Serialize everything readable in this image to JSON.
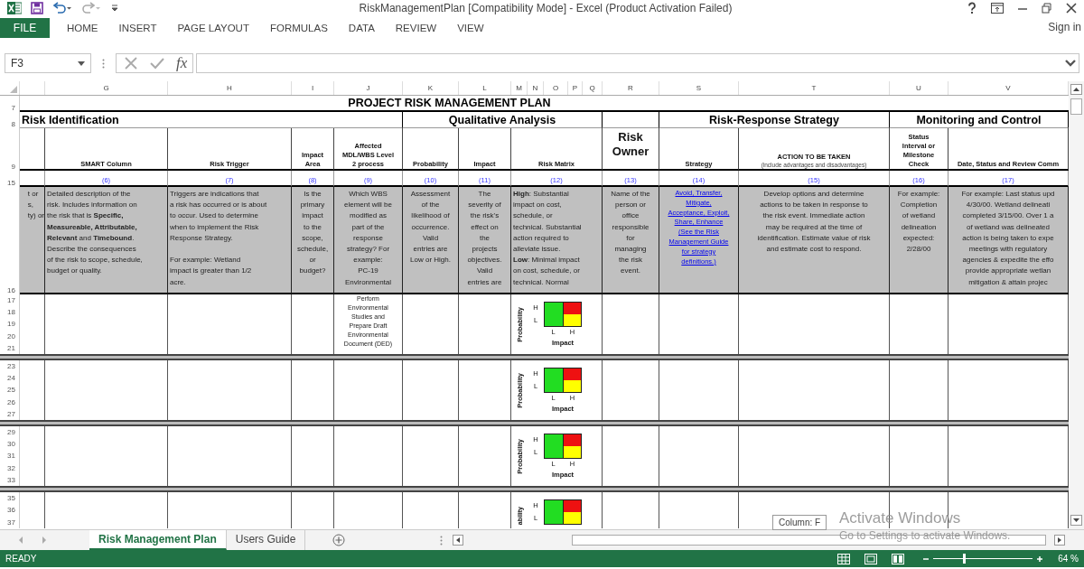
{
  "title_bar": {
    "title": "RiskManagementPlan  [Compatibility Mode] - Excel (Product Activation Failed)"
  },
  "ribbon": {
    "file_button": "FILE",
    "tabs": [
      "HOME",
      "INSERT",
      "PAGE LAYOUT",
      "FORMULAS",
      "DATA",
      "REVIEW",
      "VIEW"
    ],
    "sign_in": "Sign in"
  },
  "formula_bar": {
    "name_box": "F3",
    "function_button": "fx"
  },
  "column_headers": [
    "G",
    "H",
    "I",
    "J",
    "K",
    "L",
    "M",
    "N",
    "O",
    "P",
    "Q",
    "R",
    "S",
    "T",
    "U",
    "V"
  ],
  "sheet": {
    "row_numbers": [
      "7",
      "8",
      "9",
      "15",
      "16"
    ],
    "title": "PROJECT RISK MANAGEMENT PLAN",
    "sections": [
      "Risk Identification",
      "Qualitative Analysis",
      "Risk-Response Strategy",
      "Monitoring and Control"
    ],
    "headers": [
      {
        "label": "SMART Column",
        "kind": "normal"
      },
      {
        "label": "Risk Trigger",
        "kind": "normal"
      },
      {
        "label": "Impact\nArea",
        "kind": "normal"
      },
      {
        "label": "Affected\nMDL/WBS Level\n2 process",
        "kind": "normal"
      },
      {
        "label": "Probability",
        "kind": "normal"
      },
      {
        "label": "Impact",
        "kind": "normal"
      },
      {
        "label": "Risk Matrix",
        "kind": "normal"
      },
      {
        "label": "Risk\nOwner",
        "kind": "large"
      },
      {
        "label": "Strategy",
        "kind": "normal"
      },
      {
        "label": "ACTION TO BE TAKEN",
        "note": "(include advantages and disadvantages)",
        "kind": "normal"
      },
      {
        "label": "Status\nInterval or\nMilestone\nCheck",
        "kind": "normal"
      },
      {
        "label": "Date, Status and Review Comm",
        "kind": "normal"
      }
    ],
    "numbers": [
      "(6)",
      "(7)",
      "(8)",
      "(9)",
      "(10)",
      "(11)",
      "(12)",
      "(13)",
      "(14)",
      "(15)",
      "(16)",
      "(17)"
    ],
    "cut_text": "t or\ns,\nty) or",
    "descriptions": [
      {
        "text": "Detailed description of the\nrisk. Includes information on\nthe risk that is **Specific,**\n**Measureable, Attributable,**\n**Relevant** and **Timebound**.\nDescribe the consequences\nof the risk to scope, schedule,\nbudget or quality.",
        "kind": "text"
      },
      {
        "text": "Triggers are indications that\na risk has occurred or is about\nto occur. Used to determine\nwhen to implement the Risk\nResponse Strategy.\n\nFor example: Wetland\nimpact is greater than 1/2\nacre.",
        "kind": "text"
      },
      {
        "text": "Is the\nprimary\nimpact\nto the\nscope,\nschedule,\nor\nbudget?",
        "kind": "text"
      },
      {
        "text": "Which WBS\nelement will be\nmodified as\npart of the\nresponse\nstrategy? For\nexample:\nPC-19\nEnvironmental",
        "kind": "text"
      },
      {
        "text": "Assessment\nof the\nlikelihood of\noccurrence.\nValid\nentries are\nLow or High.",
        "kind": "text"
      },
      {
        "text": "The\nseverity of\nthe risk's\neffect on\nthe\nprojects\nobjectives.\nValid\nentries are",
        "kind": "text"
      },
      {
        "text": "**High**: Substantial\nimpact on cost,\nschedule, or\ntechnical. Substantial\naction required to\nalleviate issue.\n**Low**: Minimal impact\non cost, schedule, or\ntechnical. Normal",
        "kind": "text"
      },
      {
        "text": "Name of the\nperson or\noffice\nresponsible\nfor\nmanaging\nthe risk\nevent.",
        "kind": "text"
      },
      {
        "text": "Avoid, Transfer,\nMitigate,\nAcceptance, Exploit,\nShare, Enhance\n(See the Risk\nManagement Guide\nfor strategy\ndefinitions.)",
        "kind": "link"
      },
      {
        "text": "Develop options and determine\nactions to be taken in response to\nthe risk event. Immediate action\nmay be required at the time of\nidentification. Estimate value of risk\nand estimate cost to respond.",
        "kind": "text"
      },
      {
        "text": "For example:\nCompletion\nof wetland\ndelineation\nexpected:\n2/28/00",
        "kind": "text"
      },
      {
        "text": "For example: Last status upd\n4/30/00. Wetland delineati\ncompleted 3/15/00. Over 1 a\nof wetland was delineated\naction is being taken to expe\nmeetings with regulatory\nagencies & expedite the effo\nprovide appropriate wetlan\nmitigation & attain projec",
        "kind": "text"
      }
    ],
    "entries": [
      {
        "row_numbers": [
          "17",
          "18",
          "19",
          "20",
          "21"
        ],
        "wbs": "Perform\nEnvironmental\nStudies and\nPrepare Draft\nEnvironmental\nDocument (DED)",
        "matrix": {
          "axis": "Probability",
          "rows": [
            "H",
            "L"
          ],
          "cols": [
            "L",
            "H"
          ],
          "axis_x": "Impact"
        }
      },
      {
        "row_numbers": [
          "23",
          "24",
          "25",
          "26",
          "27"
        ],
        "matrix": {
          "axis": "Probability",
          "rows": [
            "H",
            "L"
          ],
          "cols": [
            "L",
            "H"
          ],
          "axis_x": "Impact"
        }
      },
      {
        "row_numbers": [
          "29",
          "30",
          "31",
          "32",
          "33"
        ],
        "matrix": {
          "axis": "Probability",
          "rows": [
            "H",
            "L"
          ],
          "cols": [
            "L",
            "H"
          ],
          "axis_x": "Impact"
        }
      },
      {
        "row_numbers": [
          "35",
          "36",
          "37"
        ],
        "matrix": {
          "axis": "ability",
          "rows": [
            "H",
            "L"
          ]
        }
      }
    ]
  },
  "sheet_tabs": [
    {
      "label": "Risk Management Plan",
      "selected": true
    },
    {
      "label": "Users Guide",
      "selected": false
    }
  ],
  "tooltip": "Column: F",
  "activation_notice": {
    "title": "Activate Windows",
    "text": "Go to Settings to activate Windows."
  },
  "status_bar": {
    "mode": "READY",
    "zoom": "64 %",
    "zoom_slider": {
      "level": 0.3
    }
  }
}
